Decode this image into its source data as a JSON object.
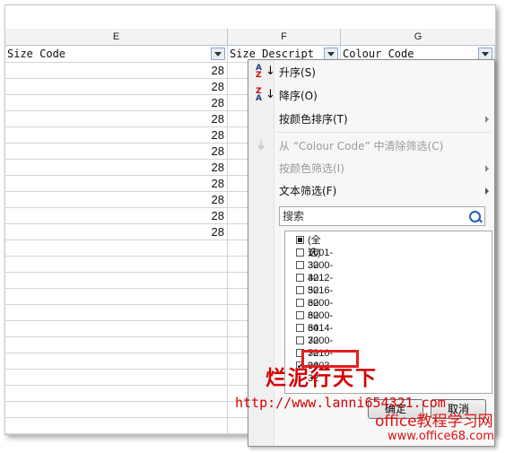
{
  "columns": [
    "E",
    "F",
    "G"
  ],
  "headers": {
    "e": "Size Code",
    "f": "Size Descript",
    "g": "Colour Code"
  },
  "e_values": [
    "28",
    "28",
    "28",
    "28",
    "28",
    "28",
    "28",
    "28",
    "28",
    "28",
    "28"
  ],
  "menu": {
    "sort_asc": "升序(S)",
    "sort_desc": "降序(O)",
    "sort_by_color": "按颜色排序(T)",
    "clear_filter": "从 “Colour Code” 中清除筛选(C)",
    "filter_by_color": "按颜色筛选(I)",
    "text_filter": "文本筛选(F)",
    "search_placeholder": "搜索",
    "select_all": "(全选)",
    "items": [
      "1001-32",
      "3000-32",
      "4012-32",
      "5016-32",
      "6000-32",
      "6000-34",
      "6014-32",
      "7000-32",
      "7010-34",
      "9003-32"
    ],
    "ok": "确定",
    "cancel": "取消"
  },
  "watermark": {
    "line1": "烂泥行天下",
    "url": "http://www.lanni654321.com",
    "site": "office教程学习网",
    "site_url": "www.office68.com"
  },
  "colors": {
    "accent": "#1d62b5",
    "highlight": "#e02020"
  }
}
